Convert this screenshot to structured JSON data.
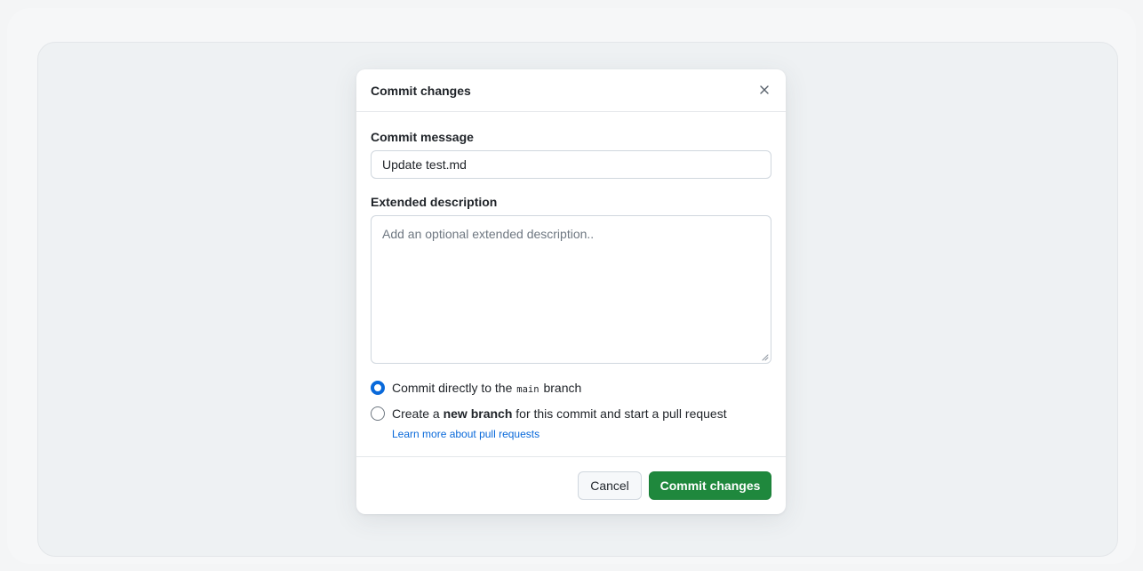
{
  "dialog": {
    "title": "Commit changes",
    "close_icon": "close-icon"
  },
  "commit_message": {
    "label": "Commit message",
    "value": "Update test.md"
  },
  "extended_description": {
    "label": "Extended description",
    "placeholder": "Add an optional extended description..",
    "value": ""
  },
  "options": {
    "direct": {
      "prefix": "Commit directly to the",
      "branch": "main",
      "suffix": "branch",
      "selected": true
    },
    "new_branch": {
      "prefix": "Create a",
      "bold": "new branch",
      "suffix": "for this commit and start a pull request",
      "selected": false
    },
    "learn_more": "Learn more about pull requests"
  },
  "buttons": {
    "cancel": "Cancel",
    "commit": "Commit changes"
  },
  "colors": {
    "accent_blue": "#0969da",
    "commit_green": "#1f883d",
    "border": "#d0d7de"
  }
}
